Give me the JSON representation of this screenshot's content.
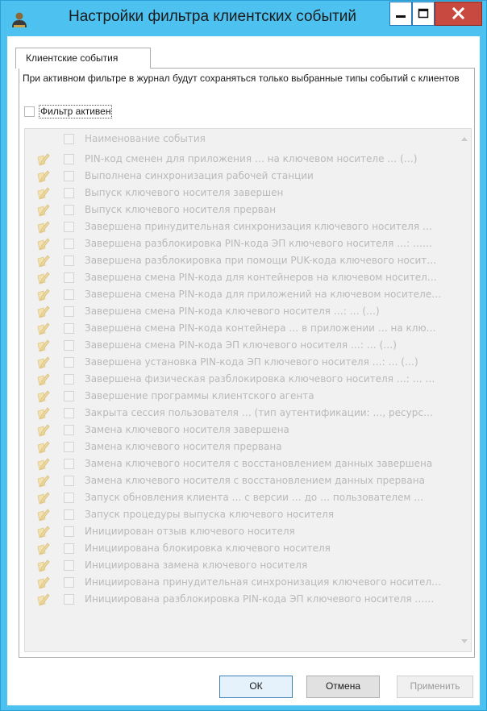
{
  "window": {
    "title": "Настройки фильтра клиентских событий",
    "accent_color": "#4dc2f0",
    "close_color": "#c7493f"
  },
  "icons": {
    "app": "user-icon",
    "minimize": "minimize-icon",
    "maximize": "maximize-icon",
    "close": "close-icon",
    "row": "document-pencil-icon"
  },
  "tabs": [
    {
      "label": "Клиентские события",
      "active": true
    }
  ],
  "panel": {
    "description": "При активном фильтре в журнал будут сохраняться только выбранные типы событий с клиентов",
    "filter_checkbox": {
      "label": "Фильтр активен",
      "checked": false
    }
  },
  "events_table": {
    "header": "Наименование события",
    "rows": [
      "PIN-код сменен для приложения … на ключевом носителе … (…)",
      "Выполнена синхронизация рабочей станции",
      "Выпуск ключевого носителя завершен",
      "Выпуск ключевого носителя прерван",
      "Завершена принудительная синхронизация ключевого носителя …",
      "Завершена разблокировка PIN-кода ЭП ключевого носителя …: ……",
      "Завершена разблокировка при помощи PUK-кода ключевого носит…",
      "Завершена смена PIN-кода для контейнеров на ключевом носител…",
      "Завершена смена PIN-кода для приложений на ключевом носителе…",
      "Завершена смена PIN-кода ключевого носителя …: … (…)",
      "Завершена смена PIN-кода контейнера … в приложении … на клю…",
      "Завершена смена PIN-кода ЭП ключевого носителя …: … (…)",
      "Завершена установка PIN-кода ЭП ключевого носителя …: … (…)",
      "Завершена физическая разблокировка ключевого носителя …: … …",
      "Завершение программы клиентского агента",
      "Закрыта сессия пользователя … (тип аутентификации: …, ресурс…",
      "Замена ключевого носителя завершена",
      "Замена ключевого носителя прервана",
      "Замена ключевого носителя с восстановлением данных завершена",
      "Замена ключевого носителя с восстановлением данных прервана",
      "Запуск обновления клиента … с версии … до … пользователем …",
      "Запуск процедуры выпуска ключевого носителя",
      "Инициирован отзыв ключевого носителя",
      "Инициирована блокировка ключевого носителя",
      "Инициирована замена ключевого носителя",
      "Инициирована принудительная синхронизация ключевого носител…",
      "Инициирована разблокировка PIN-кода ЭП ключевого носителя ……"
    ]
  },
  "buttons": {
    "ok": "ОК",
    "cancel": "Отмена",
    "apply": "Применить"
  }
}
